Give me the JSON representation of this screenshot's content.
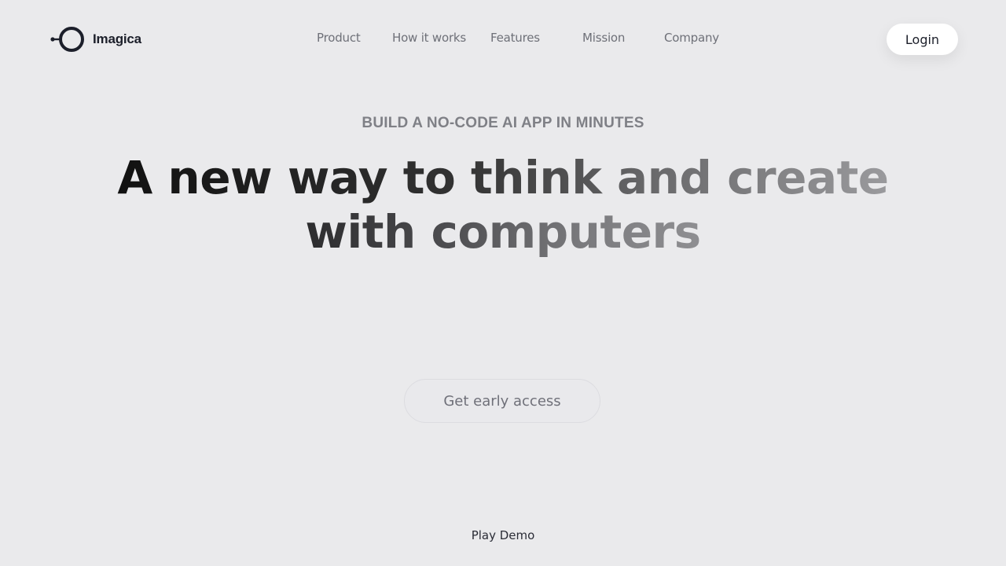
{
  "brand": {
    "name": "Imagica",
    "color": "#1c1f2a"
  },
  "nav": {
    "items": [
      {
        "label": "Product"
      },
      {
        "label": "How it works"
      },
      {
        "label": "Features"
      },
      {
        "label": "Mission"
      },
      {
        "label": "Company"
      }
    ],
    "login_label": "Login"
  },
  "hero": {
    "eyebrow": "BUILD A NO-CODE AI APP IN MINUTES",
    "headline_line1": "A new way to think and create",
    "headline_line2": "with computers",
    "cta_label": "Get early access",
    "demo_label": "Play Demo"
  },
  "colors": {
    "background": "#eaeaec",
    "text_primary": "#111111",
    "text_muted": "#6e7078"
  }
}
